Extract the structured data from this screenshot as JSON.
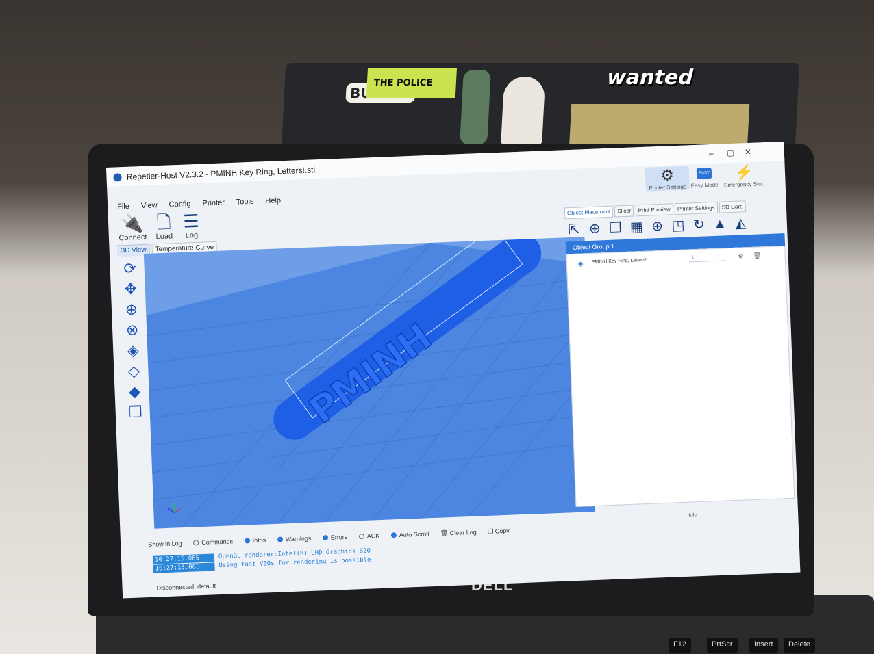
{
  "window": {
    "title": "Repetier-Host V2.3.2 - PMINH Key Ring, Letters!.stl",
    "controls": [
      "–",
      "▢",
      "✕"
    ]
  },
  "menu": [
    "File",
    "View",
    "Config",
    "Printer",
    "Tools",
    "Help"
  ],
  "toolbar": [
    {
      "label": "Connect",
      "icon": "plug-icon"
    },
    {
      "label": "Load",
      "icon": "load-file-icon"
    },
    {
      "label": "Log",
      "icon": "log-list-icon"
    }
  ],
  "top_right_tools": [
    {
      "label": "Printer Settings",
      "icon": "gear-icon"
    },
    {
      "label": "Easy Mode",
      "icon": "easy-mode-icon",
      "badge": "EASY"
    },
    {
      "label": "Emergency Stop",
      "icon": "lightning-icon"
    }
  ],
  "view_tabs": [
    "3D View",
    "Temperature Curve"
  ],
  "right_tabs": [
    "Object Placement",
    "Slicer",
    "Print Preview",
    "Printer Settings",
    "SD Card"
  ],
  "object_group": {
    "header": "Object Group 1",
    "items": [
      {
        "name": "PMINH Key Ring, Letters!",
        "quantity": "1"
      }
    ]
  },
  "model": {
    "letters": "PMINH",
    "color": "#1f5fe6",
    "bed_color": "#6f9ee8"
  },
  "log_options": {
    "show_label": "Show in Log",
    "options": [
      {
        "label": "Commands",
        "on": false
      },
      {
        "label": "Infos",
        "on": true
      },
      {
        "label": "Warnings",
        "on": true
      },
      {
        "label": "Errors",
        "on": true
      },
      {
        "label": "ACK",
        "on": false
      },
      {
        "label": "Auto Scroll",
        "on": true
      }
    ],
    "clear": "Clear Log",
    "copy": "Copy"
  },
  "log_lines": [
    {
      "time": "10:27:15.065",
      "message": "OpenGL renderer:Intel(R) UHD Graphics 620"
    },
    {
      "time": "10:27:15.065",
      "message": "Using fast VBOs for rendering is possible"
    }
  ],
  "status": {
    "connection": "Disconnected: default",
    "state": "Idle"
  },
  "laptop": {
    "brand": "DELL",
    "keys": [
      "F12",
      "PrtScr",
      "Insert",
      "Delete"
    ]
  },
  "background_stickers": [
    "BUT FIR",
    "THE POLICE",
    "wanted"
  ]
}
